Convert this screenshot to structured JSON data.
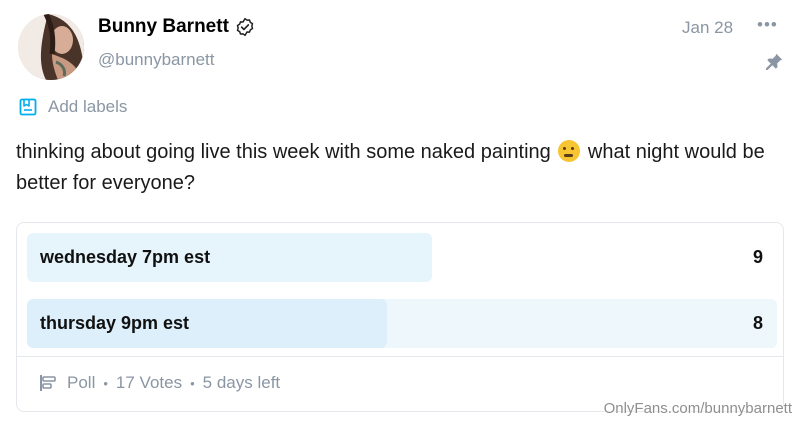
{
  "author": {
    "name": "Bunny Barnett",
    "handle": "@bunnybarnett"
  },
  "post": {
    "date": "Jan 28",
    "more_label": "•••",
    "add_labels": "Add labels",
    "text_before_emoji": "thinking about going live this week with some naked painting",
    "emoji": "thinking-face-emoji",
    "text_after_emoji": "what night would be better for everyone?"
  },
  "poll": {
    "options": [
      {
        "label": "wednesday 7pm est",
        "votes": "9",
        "fill_fraction": 0.54
      },
      {
        "label": "thursday 9pm est",
        "votes": "8",
        "fill_fraction": 0.48
      }
    ],
    "type_label": "Poll",
    "votes_label": "17 Votes",
    "time_left": "5 days left",
    "separator": "•"
  },
  "watermark": "OnlyFans.com/bunnybarnett",
  "colors": {
    "muted_text": "#8a96a3",
    "poll_fill": "#e6f4fb",
    "poll_track": "#eef7fc",
    "accent": "#00aff0"
  },
  "icons": {
    "verified": "verified-badge-icon",
    "more": "more-dots-icon",
    "pin": "pin-icon",
    "labels": "label-bookmark-icon",
    "poll": "poll-icon"
  }
}
